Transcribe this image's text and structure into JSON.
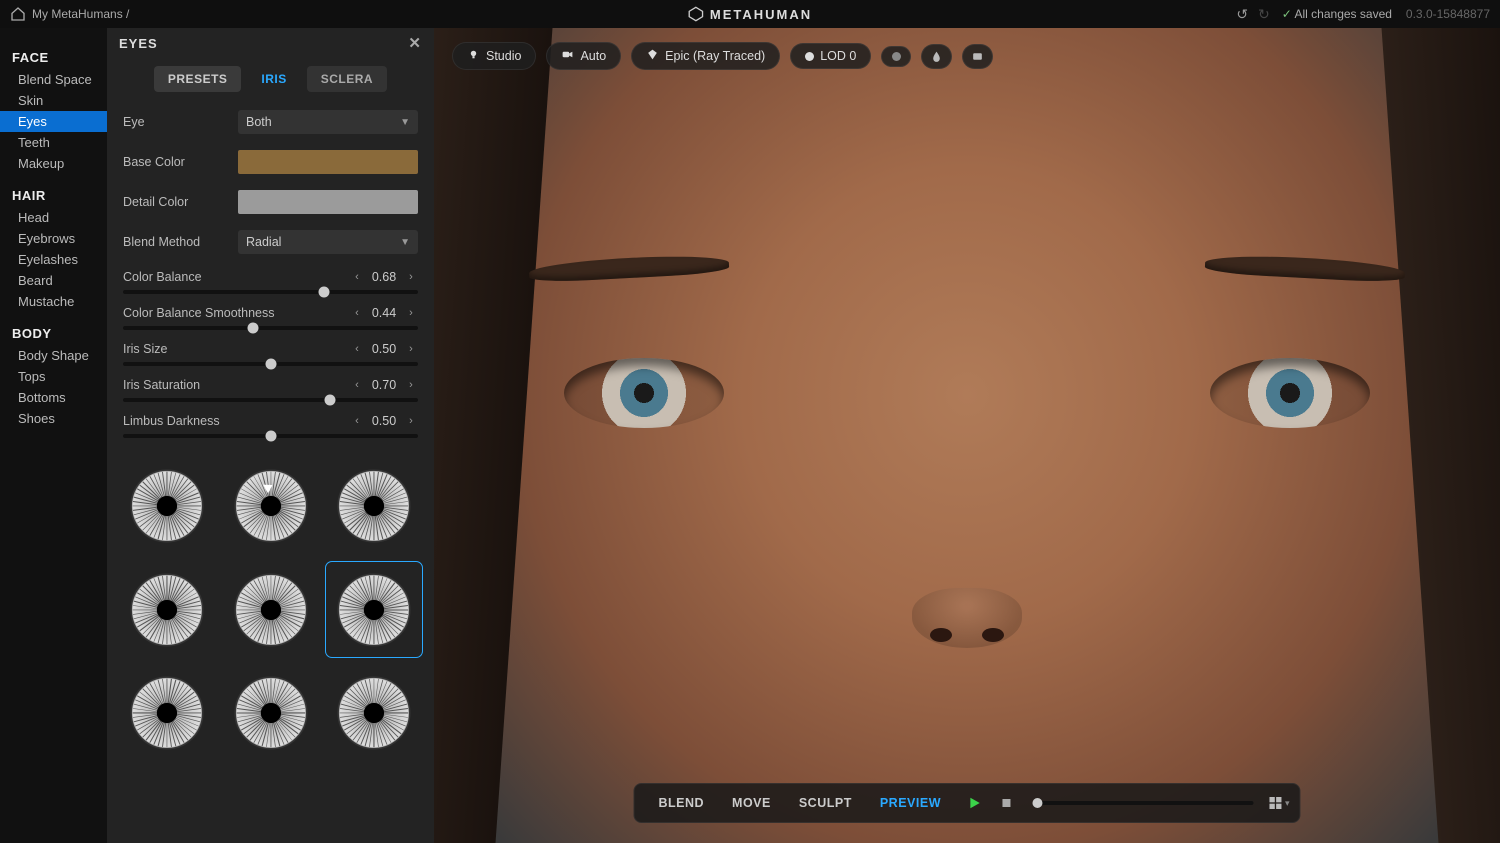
{
  "topbar": {
    "breadcrumb": "My MetaHumans /",
    "brand": "METAHUMAN",
    "saved_label": "All changes saved",
    "version": "0.3.0-15848877"
  },
  "nav": {
    "categories": [
      {
        "name": "FACE",
        "items": [
          "Blend Space",
          "Skin",
          "Eyes",
          "Teeth",
          "Makeup"
        ],
        "active_index": 2
      },
      {
        "name": "HAIR",
        "items": [
          "Head",
          "Eyebrows",
          "Eyelashes",
          "Beard",
          "Mustache"
        ],
        "active_index": -1
      },
      {
        "name": "BODY",
        "items": [
          "Body Shape",
          "Tops",
          "Bottoms",
          "Shoes"
        ],
        "active_index": -1
      }
    ]
  },
  "panel": {
    "title": "EYES",
    "tabs": [
      "PRESETS",
      "IRIS",
      "SCLERA"
    ],
    "active_tab": 1,
    "eye_label": "Eye",
    "eye_value": "Both",
    "base_color_label": "Base Color",
    "base_color_hex": "#8a6a3a",
    "detail_color_label": "Detail Color",
    "detail_color_hex": "#9b9b9b",
    "blend_method_label": "Blend Method",
    "blend_method_value": "Radial",
    "sliders": [
      {
        "label": "Color Balance",
        "value": "0.68",
        "pos": 0.68
      },
      {
        "label": "Color Balance Smoothness",
        "value": "0.44",
        "pos": 0.44
      },
      {
        "label": "Iris Size",
        "value": "0.50",
        "pos": 0.5
      },
      {
        "label": "Iris Saturation",
        "value": "0.70",
        "pos": 0.7
      },
      {
        "label": "Limbus Darkness",
        "value": "0.50",
        "pos": 0.5
      }
    ],
    "iris_patterns": 9,
    "selected_pattern": 5
  },
  "viewport_top": {
    "lighting_label": "Studio",
    "camera_label": "Auto",
    "quality_label": "Epic (Ray Traced)",
    "lod_label": "LOD 0"
  },
  "viewport_bottom": {
    "modes": [
      "BLEND",
      "MOVE",
      "SCULPT",
      "PREVIEW"
    ],
    "active_mode": 3
  }
}
